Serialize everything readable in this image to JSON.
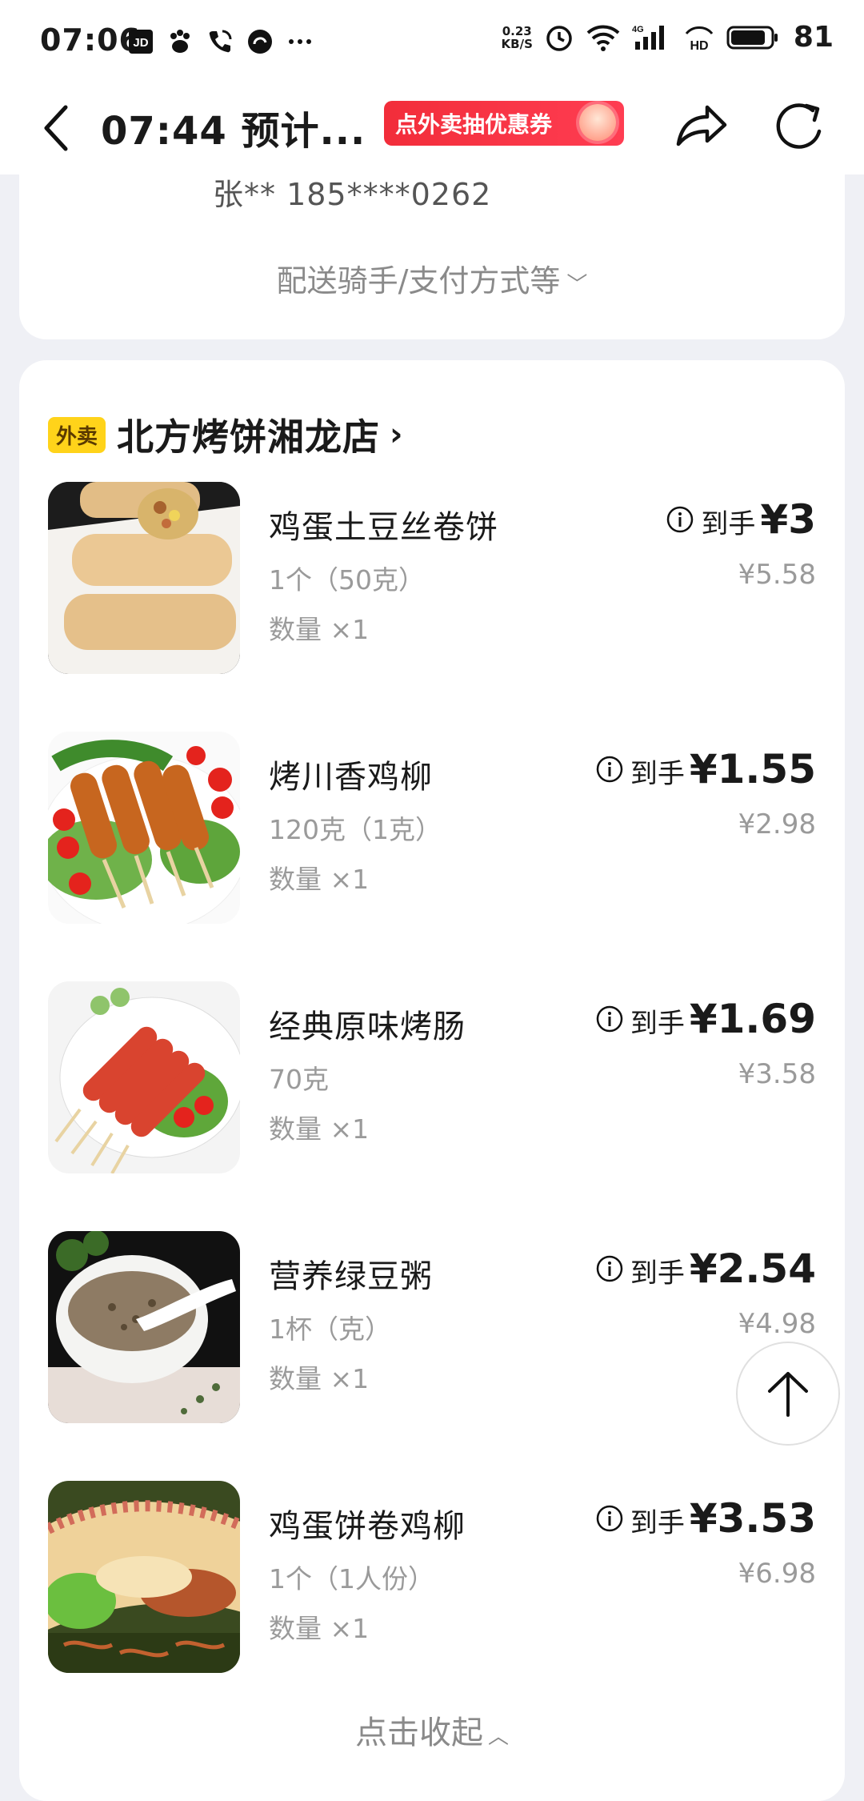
{
  "status_bar": {
    "time": "07:06",
    "left_icons": [
      "jd-icon",
      "baidu-icon",
      "phone-call-icon",
      "app-swirl-icon",
      "more-dots-icon"
    ],
    "net_speed_top": "0.23",
    "net_speed_bottom": "KB/S",
    "battery_level": "81"
  },
  "nav": {
    "title": "07:44 预计...",
    "promo": "点外卖抽优惠券"
  },
  "delivery": {
    "contact": "张**  185****0262",
    "more_label": "配送骑手/支付方式等",
    "more_chevron": "﹀"
  },
  "store": {
    "tag": "外卖",
    "name": "北方烤饼湘龙店",
    "chevron": "›"
  },
  "items": [
    {
      "name": "鸡蛋土豆丝卷饼",
      "spec": "1个（50克）",
      "qty": "数量 ×1",
      "price_label": "到手",
      "price": "¥3",
      "orig": "¥5.58"
    },
    {
      "name": "烤川香鸡柳",
      "spec": "120克（1克）",
      "qty": "数量 ×1",
      "price_label": "到手",
      "price": "¥1.55",
      "orig": "¥2.98"
    },
    {
      "name": "经典原味烤肠",
      "spec": "70克",
      "qty": "数量 ×1",
      "price_label": "到手",
      "price": "¥1.69",
      "orig": "¥3.58"
    },
    {
      "name": "营养绿豆粥",
      "spec": "1杯（克）",
      "qty": "数量 ×1",
      "price_label": "到手",
      "price": "¥2.54",
      "orig": "¥4.98"
    },
    {
      "name": "鸡蛋饼卷鸡柳",
      "spec": "1个（1人份）",
      "qty": "数量 ×1",
      "price_label": "到手",
      "price": "¥3.53",
      "orig": "¥6.98"
    }
  ],
  "collapse": {
    "label": "点击收起",
    "chevron": "︿"
  },
  "colors": {
    "page_bg": "#eff0f5",
    "promo_red": "#f22d3a",
    "tag_yellow": "#ffd31a",
    "muted_text": "#9a9a9a"
  }
}
